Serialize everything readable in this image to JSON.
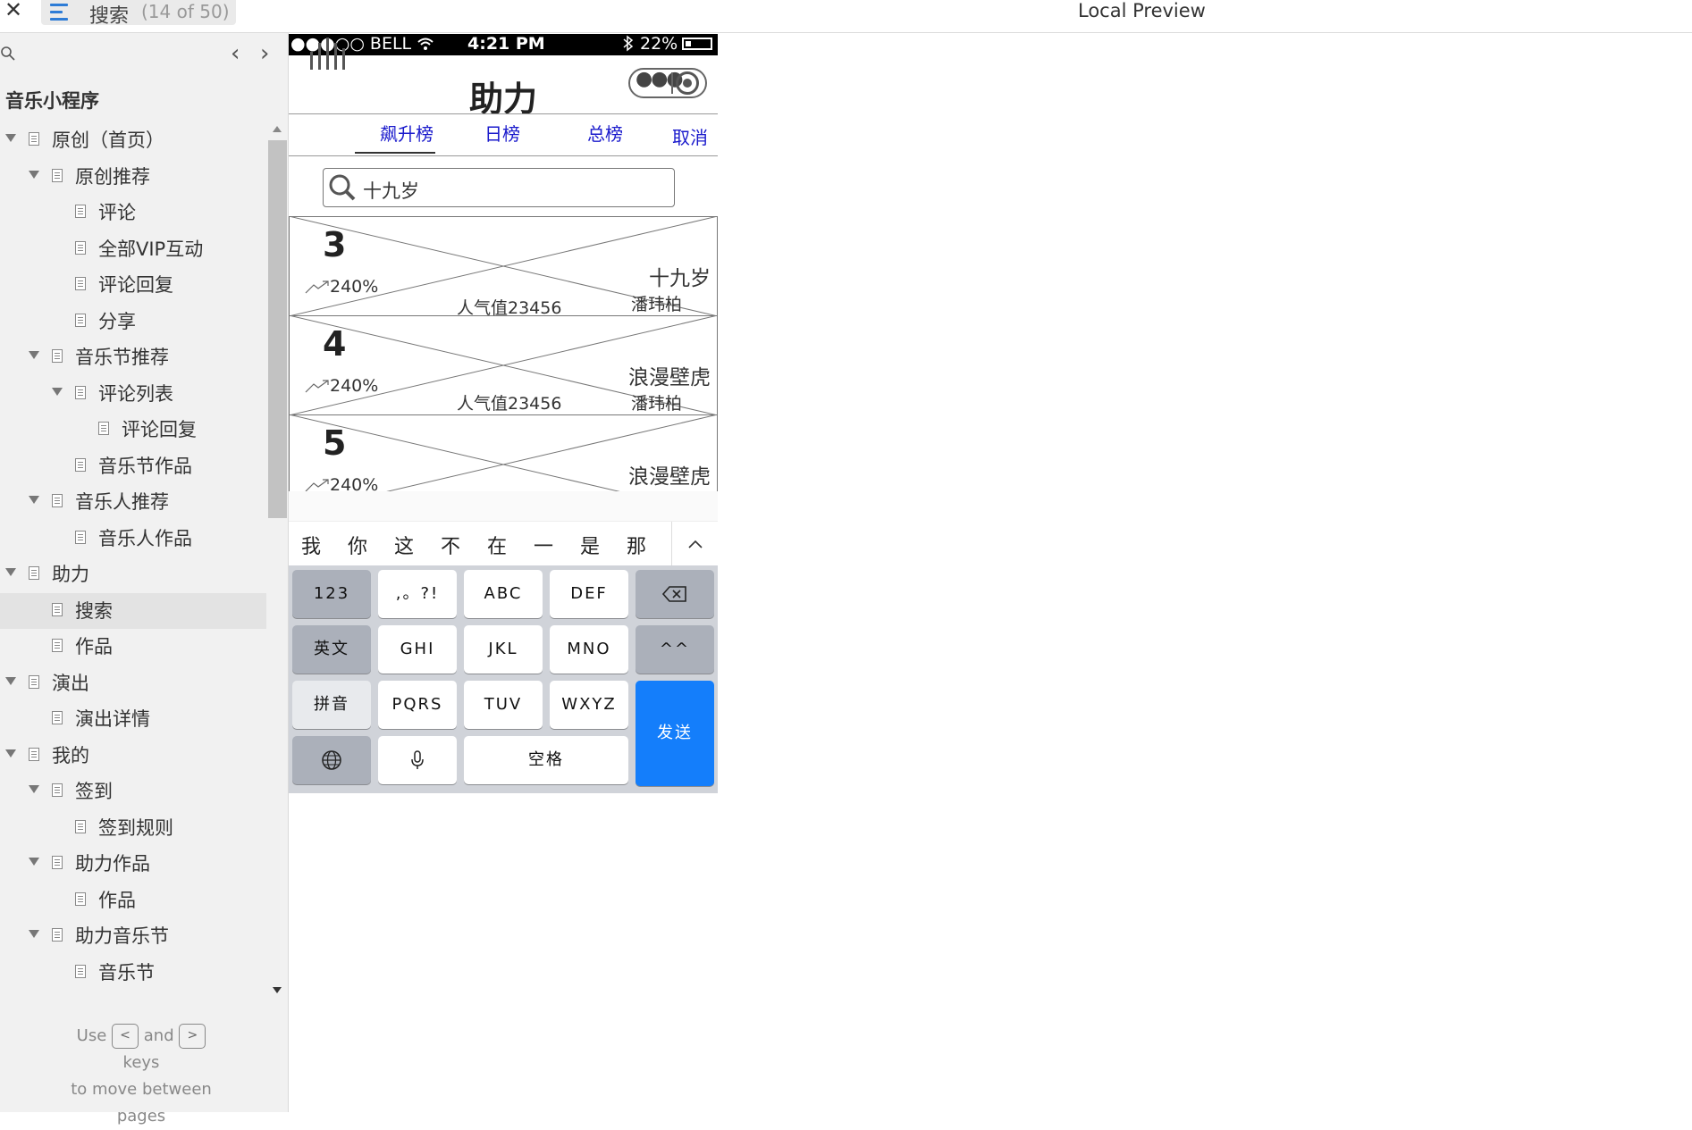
{
  "topbar": {
    "close": "✕",
    "page_name": "搜索",
    "page_count": "(14 of 50)",
    "preview_title": "Local Preview"
  },
  "sidebar": {
    "project_title": "音乐小程序",
    "tree": [
      {
        "label": "原创（首页）",
        "level": 0,
        "expandable": true
      },
      {
        "label": "原创推荐",
        "level": 1,
        "expandable": true
      },
      {
        "label": "评论",
        "level": 2,
        "expandable": false
      },
      {
        "label": "全部VIP互动",
        "level": 2,
        "expandable": false
      },
      {
        "label": "评论回复",
        "level": 2,
        "expandable": false
      },
      {
        "label": "分享",
        "level": 2,
        "expandable": false
      },
      {
        "label": "音乐节推荐",
        "level": 1,
        "expandable": true
      },
      {
        "label": "评论列表",
        "level": 2,
        "expandable": true
      },
      {
        "label": "评论回复",
        "level": 3,
        "expandable": false
      },
      {
        "label": "音乐节作品",
        "level": 2,
        "expandable": false
      },
      {
        "label": "音乐人推荐",
        "level": 1,
        "expandable": true
      },
      {
        "label": "音乐人作品",
        "level": 2,
        "expandable": false
      },
      {
        "label": "助力",
        "level": 0,
        "expandable": true
      },
      {
        "label": "搜索",
        "level": 1,
        "expandable": false,
        "selected": true
      },
      {
        "label": "作品",
        "level": 1,
        "expandable": false
      },
      {
        "label": "演出",
        "level": 0,
        "expandable": true
      },
      {
        "label": "演出详情",
        "level": 1,
        "expandable": false
      },
      {
        "label": "我的",
        "level": 0,
        "expandable": true
      },
      {
        "label": "签到",
        "level": 1,
        "expandable": true
      },
      {
        "label": "签到规则",
        "level": 2,
        "expandable": false
      },
      {
        "label": "助力作品",
        "level": 1,
        "expandable": true
      },
      {
        "label": "作品",
        "level": 2,
        "expandable": false
      },
      {
        "label": "助力音乐节",
        "level": 1,
        "expandable": true
      },
      {
        "label": "音乐节",
        "level": 2,
        "expandable": false
      }
    ],
    "hint": {
      "use": "Use",
      "and": "and",
      "keys": "keys",
      "line2": "to move between",
      "line3": "pages",
      "prev_key": "<",
      "next_key": ">"
    }
  },
  "phone": {
    "status": {
      "carrier": "●●●○○ BELL",
      "time": "4:21 PM",
      "battery": "22%"
    },
    "nav_title": "助力",
    "tabs": [
      {
        "label": "飙升榜",
        "active": true
      },
      {
        "label": "日榜",
        "active": false
      },
      {
        "label": "总榜",
        "active": false
      }
    ],
    "cancel_label": "取消",
    "search_value": "十九岁",
    "results": [
      {
        "rank": "3",
        "trend": "240%",
        "popularity": "人气值23456",
        "song": "十九岁",
        "artist": "潘玮柏"
      },
      {
        "rank": "4",
        "trend": "240%",
        "popularity": "人气值23456",
        "song": "浪漫壁虎",
        "artist": "潘玮柏"
      },
      {
        "rank": "5",
        "trend": "240%",
        "popularity": "",
        "song": "浪漫壁虎",
        "artist": ""
      }
    ],
    "keyboard": {
      "candidates": [
        "我",
        "你",
        "这",
        "不",
        "在",
        "一",
        "是",
        "那"
      ],
      "keys": {
        "k123": "123",
        "punct": ",。?!",
        "abc": "ABC",
        "def": "DEF",
        "english": "英文",
        "ghi": "GHI",
        "jkl": "JKL",
        "mno": "MNO",
        "emoji": "^^",
        "pinyin": "拼音",
        "pqrs": "PQRS",
        "tuv": "TUV",
        "wxyz": "WXYZ",
        "send": "发送",
        "space": "空格"
      }
    }
  },
  "colors": {
    "tab_blue": "#1a1acc",
    "send_blue": "#147efb",
    "menu_blue": "#2e7cd6"
  }
}
